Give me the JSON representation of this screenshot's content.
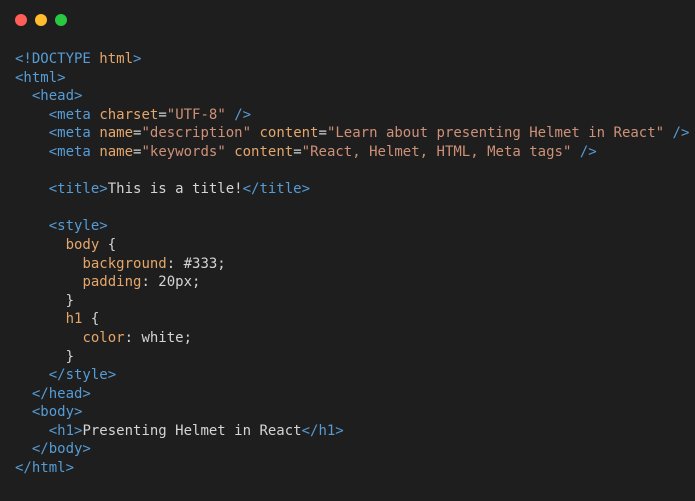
{
  "window": {
    "controls": {
      "close_color": "#ff5f57",
      "minimize_color": "#febc2e",
      "zoom_color": "#28c840"
    }
  },
  "colors": {
    "background": "#1e1e1e",
    "tag": "#569cd6",
    "attribute": "#e5a66b",
    "string": "#ce9178",
    "text": "#d4d4d4"
  },
  "code": {
    "lines": [
      [
        {
          "t": "tag",
          "v": "<!DOCTYPE"
        },
        {
          "t": "plain",
          "v": " "
        },
        {
          "t": "attr",
          "v": "html"
        },
        {
          "t": "tag",
          "v": ">"
        }
      ],
      [
        {
          "t": "tag",
          "v": "<html>"
        }
      ],
      [
        {
          "t": "plain",
          "v": "  "
        },
        {
          "t": "tag",
          "v": "<head>"
        }
      ],
      [
        {
          "t": "plain",
          "v": "    "
        },
        {
          "t": "tag",
          "v": "<meta"
        },
        {
          "t": "plain",
          "v": " "
        },
        {
          "t": "attr",
          "v": "charset"
        },
        {
          "t": "plain",
          "v": "="
        },
        {
          "t": "str",
          "v": "\"UTF-8\""
        },
        {
          "t": "plain",
          "v": " "
        },
        {
          "t": "tag",
          "v": "/>"
        }
      ],
      [
        {
          "t": "plain",
          "v": "    "
        },
        {
          "t": "tag",
          "v": "<meta"
        },
        {
          "t": "plain",
          "v": " "
        },
        {
          "t": "attr",
          "v": "name"
        },
        {
          "t": "plain",
          "v": "="
        },
        {
          "t": "str",
          "v": "\"description\""
        },
        {
          "t": "plain",
          "v": " "
        },
        {
          "t": "attr",
          "v": "content"
        },
        {
          "t": "plain",
          "v": "="
        },
        {
          "t": "str",
          "v": "\"Learn about presenting Helmet in React\""
        },
        {
          "t": "plain",
          "v": " "
        },
        {
          "t": "tag",
          "v": "/>"
        }
      ],
      [
        {
          "t": "plain",
          "v": "    "
        },
        {
          "t": "tag",
          "v": "<meta"
        },
        {
          "t": "plain",
          "v": " "
        },
        {
          "t": "attr",
          "v": "name"
        },
        {
          "t": "plain",
          "v": "="
        },
        {
          "t": "str",
          "v": "\"keywords\""
        },
        {
          "t": "plain",
          "v": " "
        },
        {
          "t": "attr",
          "v": "content"
        },
        {
          "t": "plain",
          "v": "="
        },
        {
          "t": "str",
          "v": "\"React, Helmet, HTML, Meta tags\""
        },
        {
          "t": "plain",
          "v": " "
        },
        {
          "t": "tag",
          "v": "/>"
        }
      ],
      [],
      [
        {
          "t": "plain",
          "v": "    "
        },
        {
          "t": "tag",
          "v": "<title>"
        },
        {
          "t": "text",
          "v": "This is a title!"
        },
        {
          "t": "tag",
          "v": "</title>"
        }
      ],
      [],
      [
        {
          "t": "plain",
          "v": "    "
        },
        {
          "t": "tag",
          "v": "<style>"
        }
      ],
      [
        {
          "t": "plain",
          "v": "      "
        },
        {
          "t": "attr",
          "v": "body"
        },
        {
          "t": "plain",
          "v": " {"
        }
      ],
      [
        {
          "t": "plain",
          "v": "        "
        },
        {
          "t": "attr",
          "v": "background"
        },
        {
          "t": "plain",
          "v": ": #333;"
        }
      ],
      [
        {
          "t": "plain",
          "v": "        "
        },
        {
          "t": "attr",
          "v": "padding"
        },
        {
          "t": "plain",
          "v": ": 20px;"
        }
      ],
      [
        {
          "t": "plain",
          "v": "      }"
        }
      ],
      [
        {
          "t": "plain",
          "v": "      "
        },
        {
          "t": "attr",
          "v": "h1"
        },
        {
          "t": "plain",
          "v": " {"
        }
      ],
      [
        {
          "t": "plain",
          "v": "        "
        },
        {
          "t": "attr",
          "v": "color"
        },
        {
          "t": "plain",
          "v": ": white;"
        }
      ],
      [
        {
          "t": "plain",
          "v": "      }"
        }
      ],
      [
        {
          "t": "plain",
          "v": "    "
        },
        {
          "t": "tag",
          "v": "</style>"
        }
      ],
      [
        {
          "t": "plain",
          "v": "  "
        },
        {
          "t": "tag",
          "v": "</head>"
        }
      ],
      [
        {
          "t": "plain",
          "v": "  "
        },
        {
          "t": "tag",
          "v": "<body>"
        }
      ],
      [
        {
          "t": "plain",
          "v": "    "
        },
        {
          "t": "tag",
          "v": "<h1>"
        },
        {
          "t": "text",
          "v": "Presenting Helmet in React"
        },
        {
          "t": "tag",
          "v": "</h1>"
        }
      ],
      [
        {
          "t": "plain",
          "v": "  "
        },
        {
          "t": "tag",
          "v": "</body>"
        }
      ],
      [
        {
          "t": "tag",
          "v": "</html>"
        }
      ]
    ]
  }
}
